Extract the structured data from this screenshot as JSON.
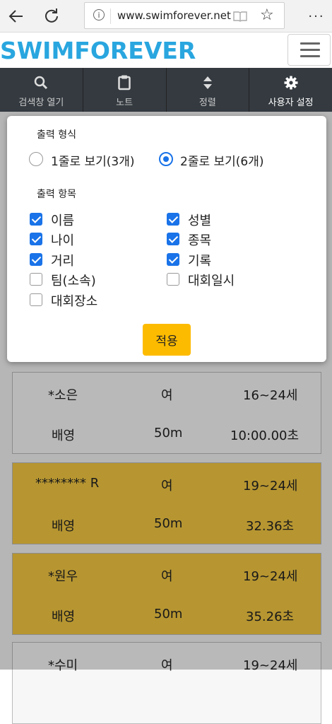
{
  "browser": {
    "url": "www.swimforever.net",
    "icons": {
      "back": "back-arrow-icon",
      "reload": "reload-icon",
      "info": "info-icon",
      "reader": "reading-view-icon",
      "favorite": "star-icon",
      "more": "more-icon"
    }
  },
  "site": {
    "logo": "SWIMFOREVER"
  },
  "toolbar": {
    "items": [
      {
        "label": "검색창 열기",
        "icon": "search-icon"
      },
      {
        "label": "노트",
        "icon": "clipboard-icon"
      },
      {
        "label": "정렬",
        "icon": "sort-icon"
      },
      {
        "label": "사용자 설정",
        "icon": "gear-icon"
      }
    ]
  },
  "settings": {
    "format_title": "출력 형식",
    "formats": [
      {
        "label": "1줄로 보기(3개)",
        "selected": false
      },
      {
        "label": "2줄로 보기(6개)",
        "selected": true
      }
    ],
    "fields_title": "출력 항목",
    "fields": [
      {
        "label": "이름",
        "checked": true
      },
      {
        "label": "성별",
        "checked": true
      },
      {
        "label": "나이",
        "checked": true
      },
      {
        "label": "종목",
        "checked": true
      },
      {
        "label": "거리",
        "checked": true
      },
      {
        "label": "기록",
        "checked": true
      },
      {
        "label": "팀(소속)",
        "checked": false
      },
      {
        "label": "대회일시",
        "checked": false
      },
      {
        "label": "대회장소",
        "checked": false
      }
    ],
    "apply_label": "적용"
  },
  "records": [
    {
      "name": "*소은",
      "gender": "여",
      "age": "16~24세",
      "event": "배영",
      "distance": "50m",
      "time": "10:00.00초",
      "highlight": false
    },
    {
      "name": "******** R",
      "gender": "여",
      "age": "19~24세",
      "event": "배영",
      "distance": "50m",
      "time": "32.36초",
      "highlight": true
    },
    {
      "name": "*원우",
      "gender": "여",
      "age": "19~24세",
      "event": "배영",
      "distance": "50m",
      "time": "35.26초",
      "highlight": true
    },
    {
      "name": "*수미",
      "gender": "여",
      "age": "19~24세",
      "event": "",
      "distance": "",
      "time": "",
      "highlight": false
    }
  ],
  "colors": {
    "logo": "#29a6df",
    "toolbar": "#343a40",
    "highlight": "#f4c842",
    "apply": "#fdbb00",
    "accent": "#1a73e8"
  }
}
